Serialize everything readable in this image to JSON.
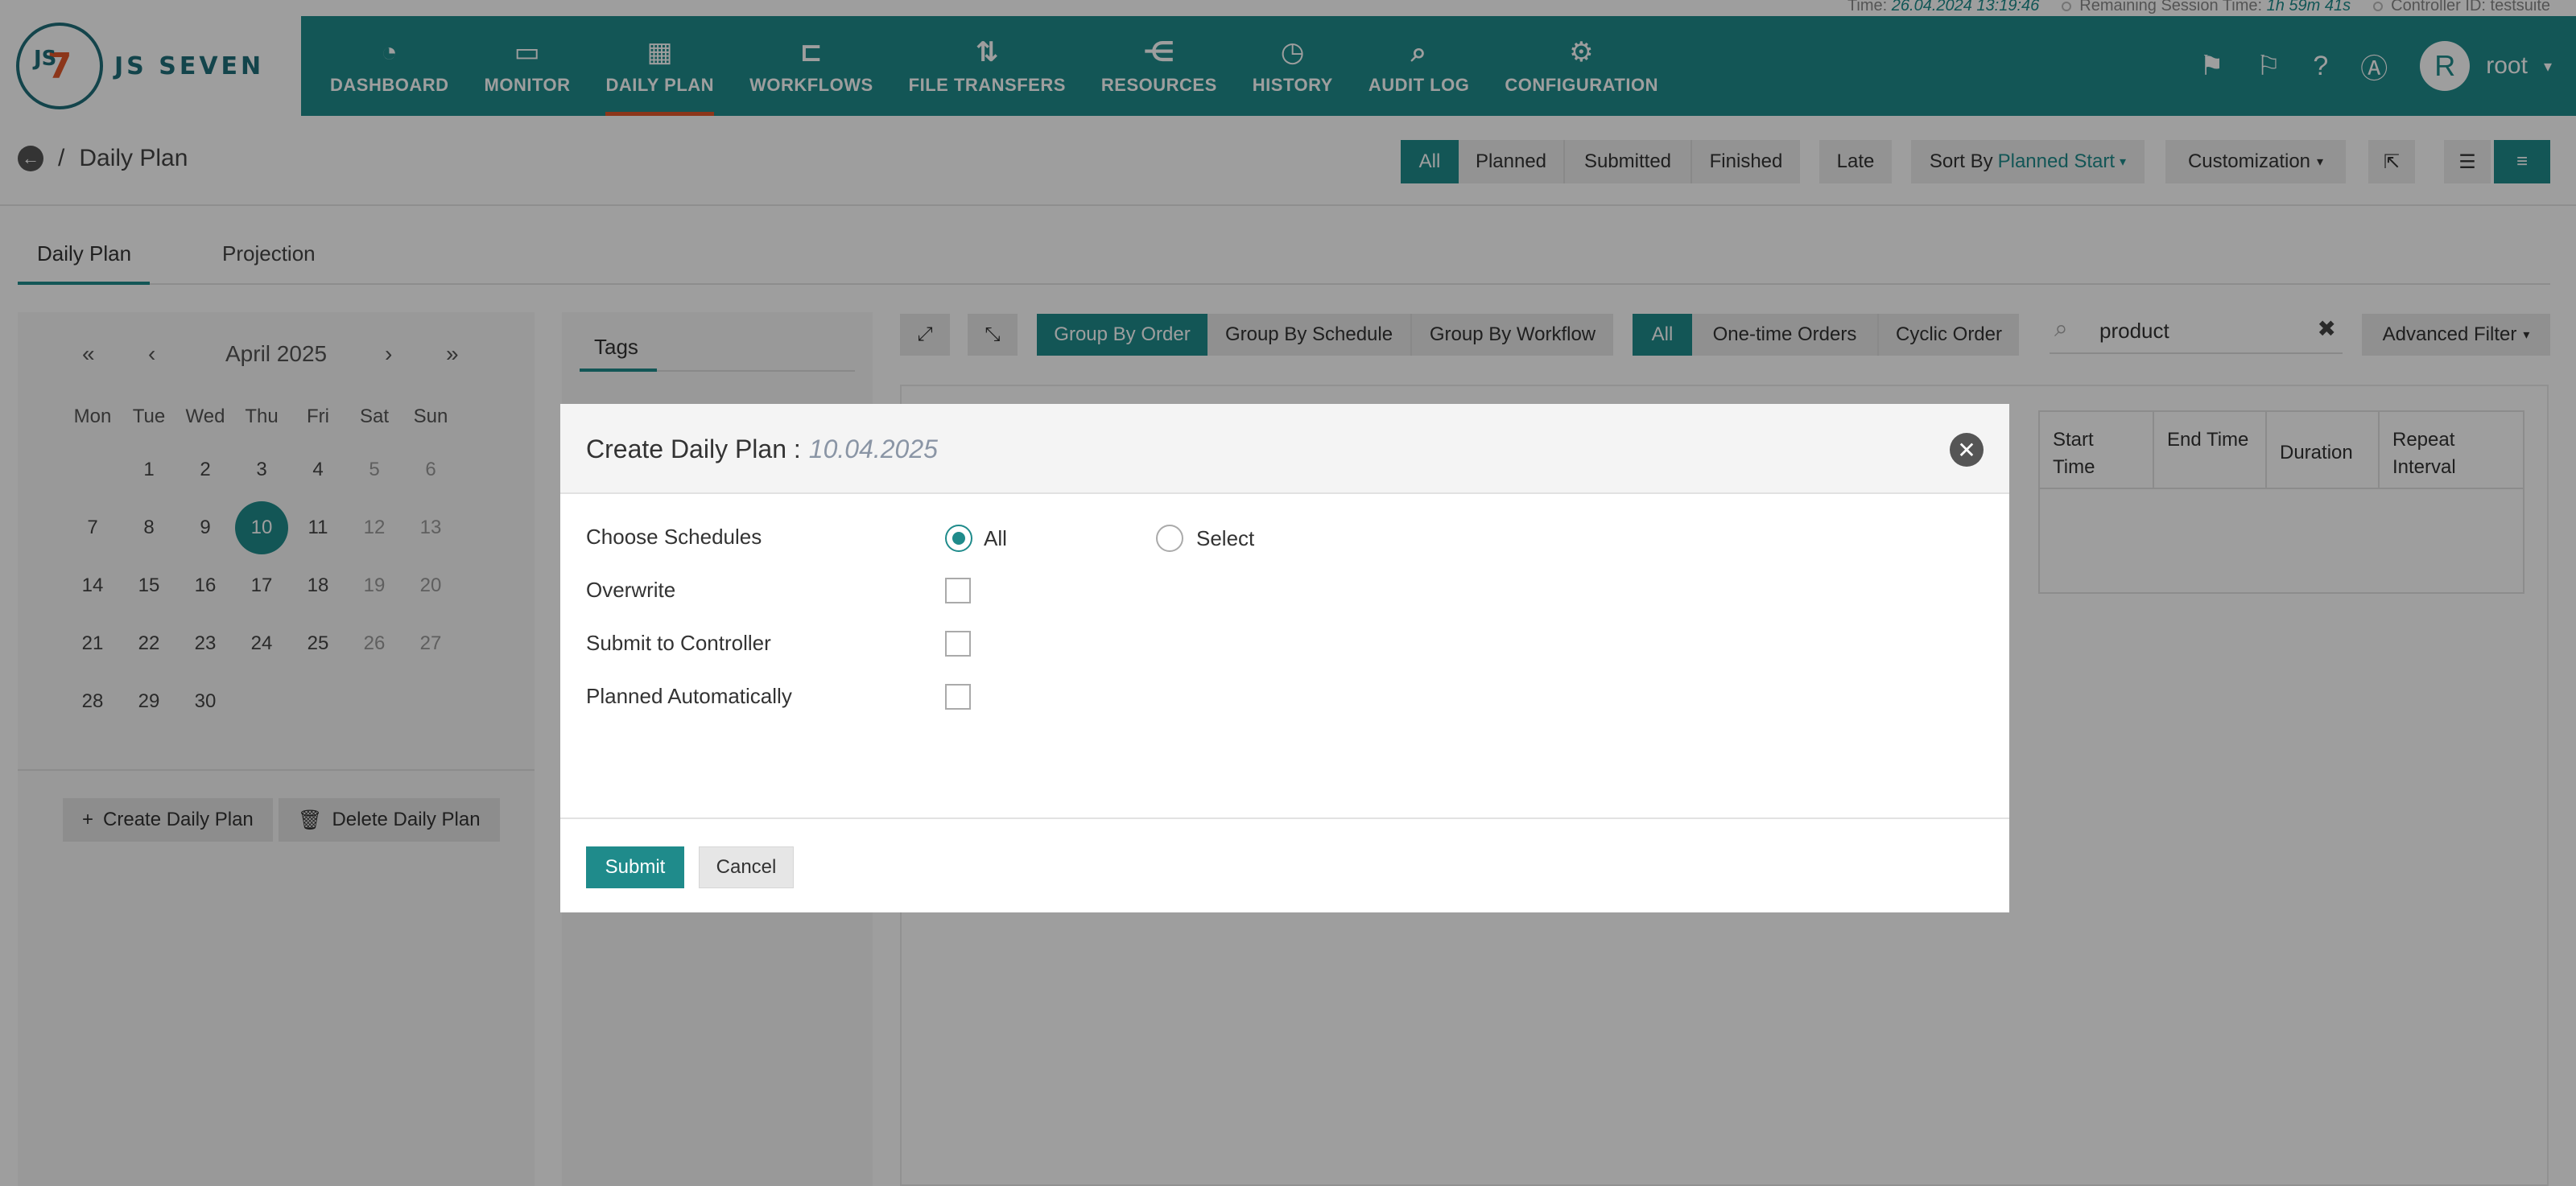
{
  "info_strip": {
    "time_label": "Time:",
    "time_value": "26.04.2024 13:19:46",
    "session_label": "Remaining Session Time:",
    "session_value": "1h 59m 41s",
    "controller_label": "Controller ID:",
    "controller_value": "testsuite"
  },
  "brand": {
    "logo_mark": "JS7",
    "logo_text": "JS SEVEN"
  },
  "nav": [
    {
      "label": "DASHBOARD",
      "icon": "dashboard-icon",
      "glyph": "◔"
    },
    {
      "label": "MONITOR",
      "icon": "monitor-icon",
      "glyph": "▭"
    },
    {
      "label": "DAILY PLAN",
      "icon": "calendar-clock-icon",
      "glyph": "▦"
    },
    {
      "label": "WORKFLOWS",
      "icon": "workflow-icon",
      "glyph": "⊏"
    },
    {
      "label": "FILE TRANSFERS",
      "icon": "transfer-icon",
      "glyph": "⇅"
    },
    {
      "label": "RESOURCES",
      "icon": "share-icon",
      "glyph": "⋲"
    },
    {
      "label": "HISTORY",
      "icon": "alarm-clock-icon",
      "glyph": "⏰"
    },
    {
      "label": "AUDIT LOG",
      "icon": "file-search-icon",
      "glyph": "⌕"
    },
    {
      "label": "CONFIGURATION",
      "icon": "gears-icon",
      "glyph": "⚙"
    }
  ],
  "user": {
    "initial": "R",
    "name": "root"
  },
  "breadcrumb": {
    "separator": "/",
    "title": "Daily Plan"
  },
  "filters": {
    "all": "All",
    "planned": "Planned",
    "submitted": "Submitted",
    "finished": "Finished",
    "late": "Late",
    "sort_label": "Sort By",
    "sort_value": "Planned Start",
    "customization": "Customization"
  },
  "tabs": {
    "daily_plan": "Daily Plan",
    "projection": "Projection"
  },
  "calendar": {
    "month": "April 2025",
    "weekdays": [
      "Mon",
      "Tue",
      "Wed",
      "Thu",
      "Fri",
      "Sat",
      "Sun"
    ],
    "weeks": [
      [
        "",
        "1",
        "2",
        "3",
        "4",
        "5",
        "6"
      ],
      [
        "7",
        "8",
        "9",
        "10",
        "11",
        "12",
        "13"
      ],
      [
        "14",
        "15",
        "16",
        "17",
        "18",
        "19",
        "20"
      ],
      [
        "21",
        "22",
        "23",
        "24",
        "25",
        "26",
        "27"
      ],
      [
        "28",
        "29",
        "30",
        "",
        "",
        "",
        ""
      ]
    ],
    "selected": "10",
    "create_button": "Create Daily Plan",
    "delete_button": "Delete Daily Plan"
  },
  "tags": {
    "title": "Tags"
  },
  "toolbar": {
    "group_by_order": "Group By Order",
    "group_by_schedule": "Group By Schedule",
    "group_by_workflow": "Group By Workflow",
    "all": "All",
    "one_time_orders": "One-time Orders",
    "cyclic_order": "Cyclic Order",
    "search_value": "product",
    "advanced_filter": "Advanced Filter"
  },
  "table": {
    "columns": [
      "Start Time",
      "End Time",
      "Duration",
      "Repeat Interval"
    ]
  },
  "modal": {
    "title": "Create Daily Plan :",
    "date": "10.04.2025",
    "choose_schedules": "Choose Schedules",
    "option_all": "All",
    "option_select": "Select",
    "selected_option": "All",
    "overwrite": "Overwrite",
    "submit_to_controller": "Submit to Controller",
    "planned_automatically": "Planned Automatically",
    "submit": "Submit",
    "cancel": "Cancel"
  },
  "colors": {
    "accent": "#1f8b8b",
    "brand_orange": "#e2572b"
  }
}
